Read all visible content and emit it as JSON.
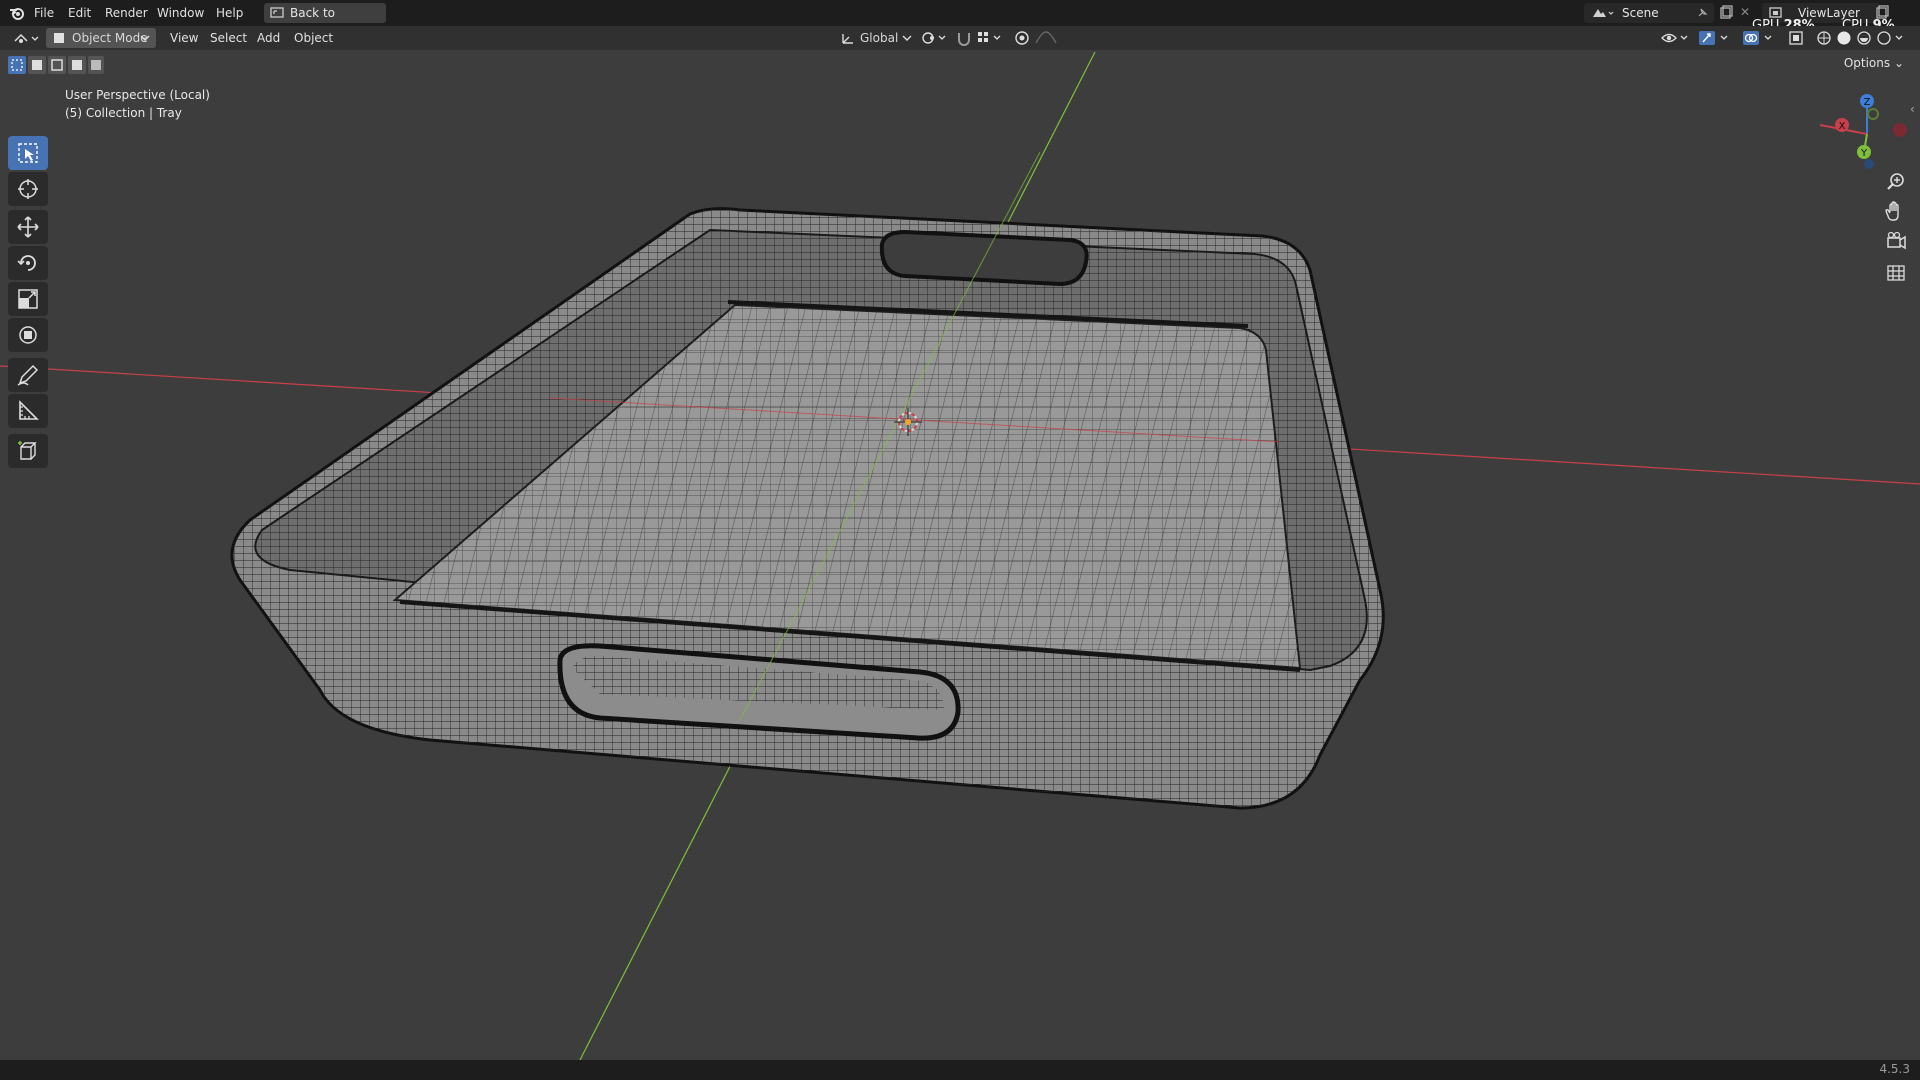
{
  "menu": {
    "items": [
      "File",
      "Edit",
      "Render",
      "Window",
      "Help"
    ],
    "back_button": "Back to Previous",
    "scene_name": "Scene",
    "view_layer": "ViewLayer",
    "gpu_label": "GPU",
    "gpu_value": "28%",
    "cpu_label": "CPU",
    "cpu_value": "9%"
  },
  "header": {
    "mode": "Object Mode",
    "menus": [
      "View",
      "Select",
      "Add",
      "Object"
    ],
    "orientation": "Global",
    "options": "Options"
  },
  "viewport": {
    "perspective": "User Perspective (Local)",
    "collection": "(5) Collection | Tray",
    "object_name": "Tray",
    "axis_colors": {
      "x": "#c8404a",
      "y": "#7fbf3a",
      "z": "#3d7ed8"
    }
  },
  "toolbar": {
    "tools": [
      "select-box",
      "cursor",
      "move",
      "rotate",
      "scale",
      "transform",
      "annotate",
      "measure",
      "add-cube"
    ],
    "active": "select-box"
  },
  "navigation": {
    "gizmo_axes": [
      "X",
      "Y",
      "Z"
    ],
    "buttons": [
      "zoom",
      "pan",
      "camera",
      "grid"
    ]
  },
  "status": {
    "version": "4.5.3"
  },
  "colors": {
    "background": "#3d3d3d",
    "active_tool": "#4772b3",
    "menubar": "#1d1d1d"
  }
}
